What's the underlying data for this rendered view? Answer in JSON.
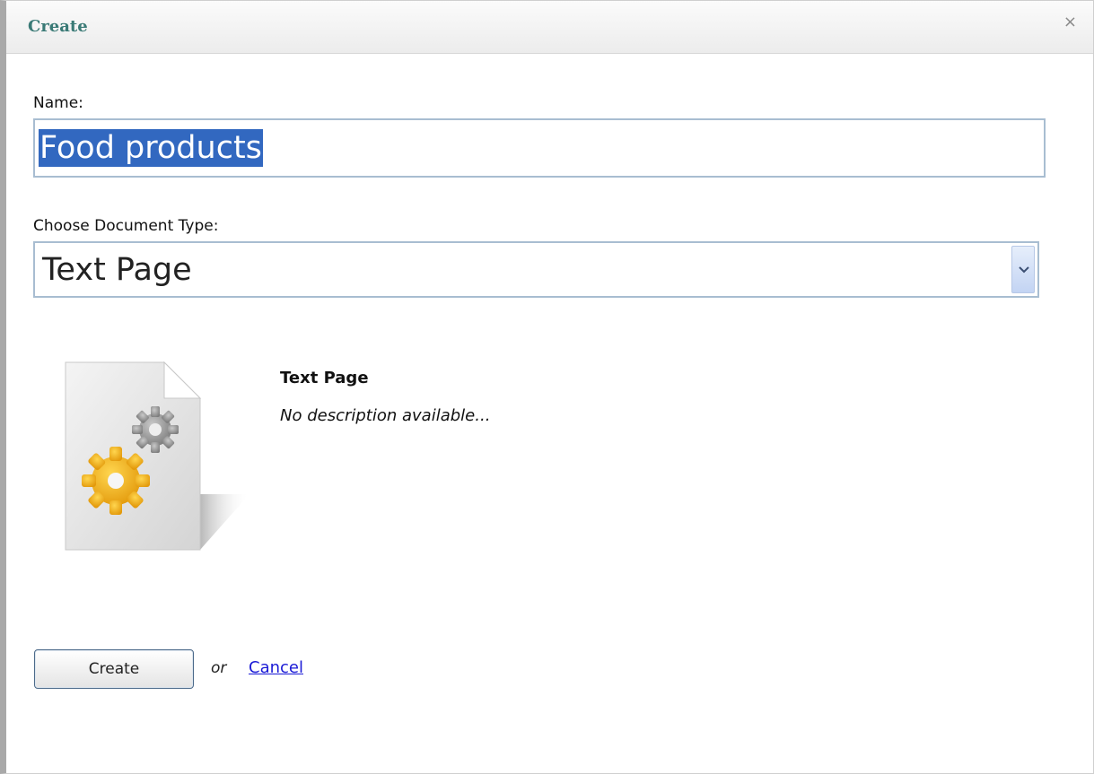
{
  "dialog": {
    "title": "Create",
    "close_label": "×"
  },
  "form": {
    "name_label": "Name:",
    "name_value": "Food products",
    "type_label": "Choose Document Type:",
    "type_selected": "Text Page"
  },
  "preview": {
    "title": "Text Page",
    "description": "No description available...",
    "icon": "document-gears-icon"
  },
  "actions": {
    "create_label": "Create",
    "or_text": "or",
    "cancel_label": "Cancel"
  },
  "colors": {
    "title": "#3a7a76",
    "selection": "#3268c0",
    "link": "#1a1ad6"
  }
}
